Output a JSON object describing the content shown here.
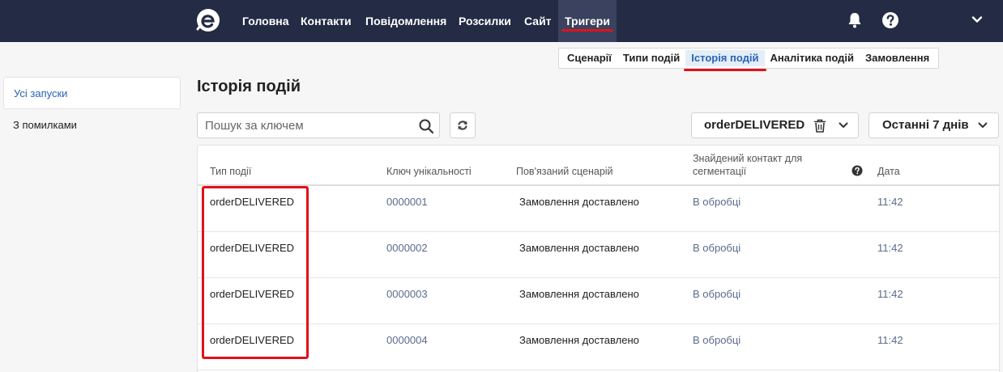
{
  "topnav": {
    "items": [
      {
        "label": "Головна"
      },
      {
        "label": "Контакти"
      },
      {
        "label": "Повідомлення"
      },
      {
        "label": "Розсилки"
      },
      {
        "label": "Сайт"
      },
      {
        "label": "Тригери"
      }
    ],
    "active": "Тригери",
    "icons": [
      "bell-icon",
      "help-icon",
      "chevron-down-icon"
    ]
  },
  "subtabs": {
    "items": [
      {
        "label": "Сценарії"
      },
      {
        "label": "Типи подій"
      },
      {
        "label": "Історія подій"
      },
      {
        "label": "Аналітика подій"
      },
      {
        "label": "Замовлення"
      }
    ],
    "active": "Історія подій"
  },
  "sidebar": {
    "items": [
      {
        "label": "Усі запуски"
      },
      {
        "label": "З помилками"
      }
    ],
    "active": "Усі запуски"
  },
  "page": {
    "title": "Історія подій"
  },
  "search": {
    "placeholder": "Пошук за ключем",
    "value": ""
  },
  "filters": {
    "event": {
      "label": "orderDELIVERED"
    },
    "date": {
      "label": "Останні 7 днів"
    }
  },
  "table": {
    "columns": [
      "Тип події",
      "Ключ унікальності",
      "Пов'язаний сценарій",
      "Знайдений контакт для сегментації",
      "Дата"
    ],
    "rows": [
      [
        "orderDELIVERED",
        "0000001",
        "Замовлення доставлено",
        "В обробці",
        "11:42"
      ],
      [
        "orderDELIVERED",
        "0000002",
        "Замовлення доставлено",
        "В обробці",
        "11:42"
      ],
      [
        "orderDELIVERED",
        "0000003",
        "Замовлення доставлено",
        "В обробці",
        "11:42"
      ],
      [
        "orderDELIVERED",
        "0000004",
        "Замовлення доставлено",
        "В обробці",
        "11:42"
      ]
    ]
  },
  "colors": {
    "topbar": "#232b45",
    "accent": "#2b62b8",
    "highlight": "#e0121b",
    "muted_value": "#5a6b8c"
  }
}
